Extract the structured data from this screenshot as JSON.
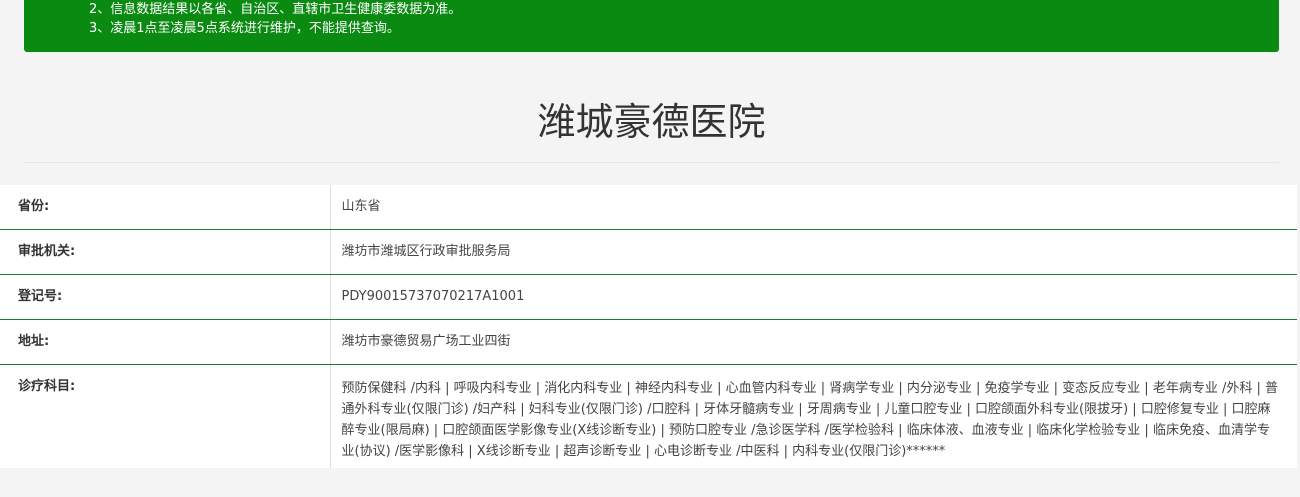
{
  "notice": {
    "lines": [
      "2、信息数据结果以各省、自治区、直辖市卫生健康委数据为准。",
      "3、凌晨1点至凌晨5点系统进行维护，不能提供查询。"
    ]
  },
  "page": {
    "title": "潍城豪德医院"
  },
  "info": {
    "rows": [
      {
        "label": "省份:",
        "value": "山东省"
      },
      {
        "label": "审批机关:",
        "value": "潍坊市潍城区行政审批服务局"
      },
      {
        "label": "登记号:",
        "value": "PDY90015737070217A1001"
      },
      {
        "label": "地址:",
        "value": "潍坊市豪德贸易广场工业四街"
      },
      {
        "label": "诊疗科目:",
        "value": "预防保健科 /内科 | 呼吸内科专业 | 消化内科专业 | 神经内科专业 | 心血管内科专业 | 肾病学专业 | 内分泌专业 | 免疫学专业 | 变态反应专业 | 老年病专业 /外科 | 普通外科专业(仅限门诊) /妇产科 | 妇科专业(仅限门诊) /口腔科 | 牙体牙髓病专业 | 牙周病专业 | 儿童口腔专业 | 口腔颌面外科专业(限拔牙) | 口腔修复专业 | 口腔麻醉专业(限局麻) | 口腔颌面医学影像专业(X线诊断专业) | 预防口腔专业 /急诊医学科 /医学检验科 | 临床体液、血液专业 | 临床化学检验专业 | 临床免疫、血清学专业(协议) /医学影像科 | X线诊断专业 | 超声诊断专业 | 心电诊断专业 /中医科 | 内科专业(仅限门诊)******"
      }
    ]
  },
  "colors": {
    "notice_bg": "#0b8a12",
    "row_border": "#1f7a3a"
  }
}
